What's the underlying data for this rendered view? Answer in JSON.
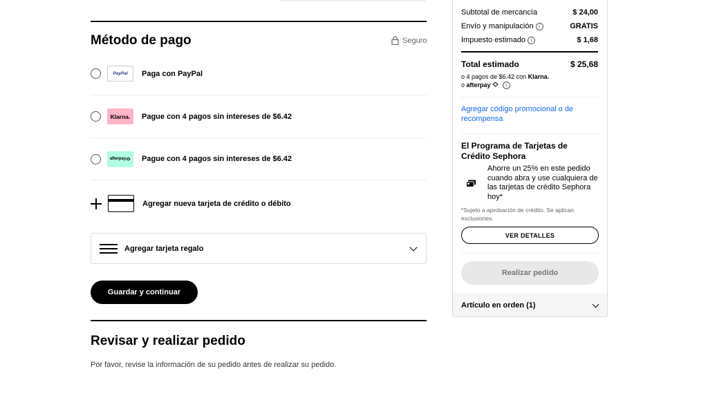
{
  "payment": {
    "title": "Método de pago",
    "secure_label": "Seguro",
    "options": [
      {
        "logo_text": "PayPal",
        "label": "Paga con PayPal"
      },
      {
        "logo_text": "Klarna.",
        "label": "Pague con 4 pagos sin intereses de $6.42"
      },
      {
        "logo_text": "afterpay",
        "label": "Pague con 4 pagos sin intereses de $6.42"
      }
    ],
    "add_card_label": "Agregar nueva tarjeta de crédito o débito",
    "gift_card_label": "Agregar tarjeta regalo",
    "save_continue_label": "Guardar y continuar"
  },
  "review": {
    "title": "Revisar y realizar pedido",
    "text": "Por favor, revise la información de su pedido antes de realizar su pedido."
  },
  "summary": {
    "subtotal_label": "Subtotal de mercancía",
    "subtotal_value": "$ 24,00",
    "shipping_label": "Envío y manipulación",
    "shipping_value": "GRATIS",
    "tax_label": "Impuesto estimado",
    "tax_value": "$ 1,68",
    "total_label": "Total estimado",
    "total_value": "$ 25,68",
    "klarna_text": "o 4 pagos de $6.42 con",
    "klarna_brand": "Klarna.",
    "afterpay_prefix": "o",
    "afterpay_brand": "afterpay",
    "promo_link": "Agregar código promocional o de recompensa",
    "cc_title": "El Programa de Tarjetas de Crédito Sephora",
    "cc_text": "Ahorre un 25% en este pedido cuando abra y use cualquiera de las tarjetas de crédito Sephora hoy*",
    "cc_note": "*Sujeto a aprobación de crédito. Se aplican exclusiones.",
    "details_button": "VER DETALLES",
    "place_order_button": "Realizar pedido",
    "items_label": "Artículo en orden (1)"
  },
  "colors": {
    "link": "#136bea",
    "klarna_pink": "#ffb3c7",
    "afterpay_mint": "#b2fce4"
  }
}
